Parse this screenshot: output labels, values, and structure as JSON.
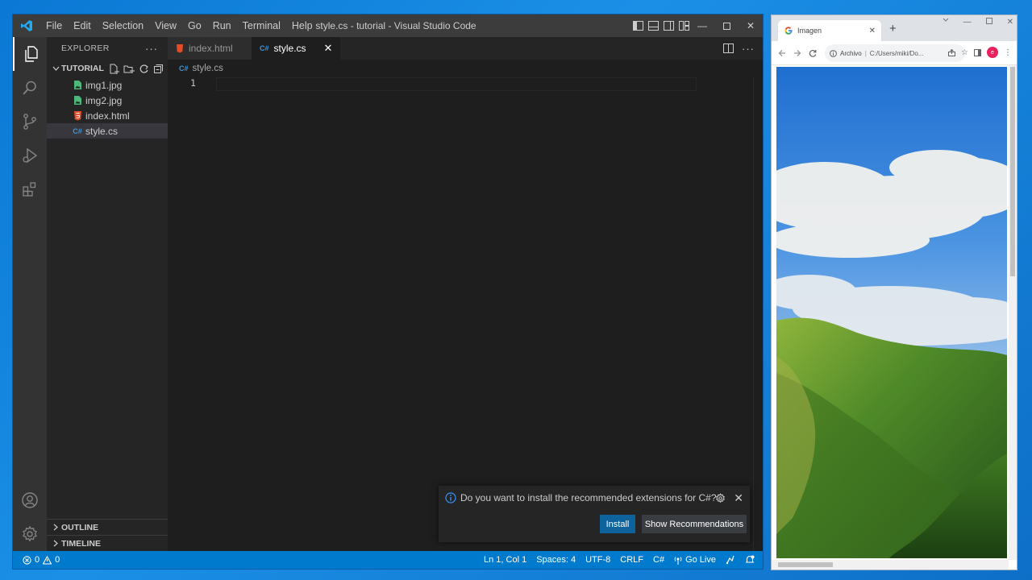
{
  "vscode": {
    "menu": [
      "File",
      "Edit",
      "Selection",
      "View",
      "Go",
      "Run",
      "Terminal",
      "Help"
    ],
    "window_title": "style.cs - tutorial - Visual Studio Code",
    "explorer": {
      "header": "EXPLORER",
      "folder": "TUTORIAL",
      "files": [
        {
          "name": "img1.jpg",
          "icon": "image-file-icon"
        },
        {
          "name": "img2.jpg",
          "icon": "image-file-icon"
        },
        {
          "name": "index.html",
          "icon": "html-file-icon"
        },
        {
          "name": "style.cs",
          "icon": "csharp-file-icon"
        }
      ],
      "outline": "OUTLINE",
      "timeline": "TIMELINE"
    },
    "tabs": [
      {
        "label": "index.html",
        "icon": "html-file-icon"
      },
      {
        "label": "style.cs",
        "icon": "csharp-file-icon",
        "active": true
      }
    ],
    "breadcrumb": "style.cs",
    "csharp_badge": "C#",
    "line_number": "1",
    "notification": {
      "message": "Do you want to install the recommended extensions for C#?",
      "install": "Install",
      "show_recommendations": "Show Recommendations"
    },
    "status": {
      "errors": "0",
      "warnings": "0",
      "position": "Ln 1, Col 1",
      "spaces": "Spaces: 4",
      "encoding": "UTF-8",
      "eol": "CRLF",
      "language": "C#",
      "go_live": "Go Live"
    },
    "colors": {
      "status_bar": "#007acc",
      "title_bar": "#3c3c3c",
      "editor_bg": "#1e1e1e",
      "sidebar_bg": "#252526"
    }
  },
  "chrome": {
    "tab_title": "Imagen",
    "omnibox_label": "Archivo",
    "url": "C:/Users/miki/Do...",
    "profile_initial": "e"
  }
}
